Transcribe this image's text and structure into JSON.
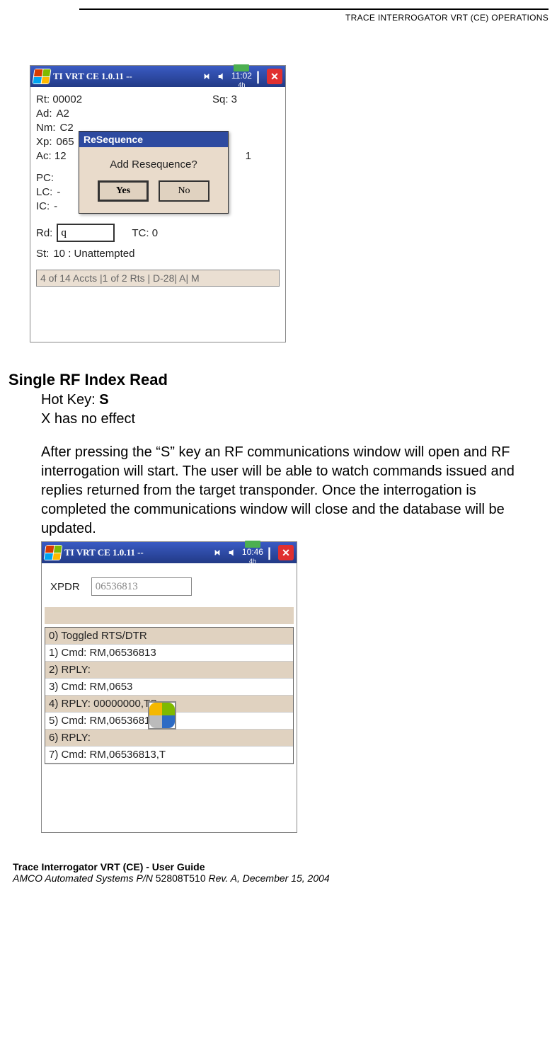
{
  "running_head": "TRACE INTERROGATOR VRT (CE) OPERATIONS",
  "device1": {
    "titlebar": {
      "title": "TI VRT CE 1.0.11 --",
      "clock": "11:02",
      "clock_sub": "4h",
      "batt": "41%"
    },
    "fields": {
      "rt_label": "Rt:",
      "rt_value": "00002",
      "sq_label": "Sq:",
      "sq_value": "3",
      "ad_label": "Ad:",
      "ad_value": "A2",
      "nm_label": "Nm:",
      "nm_value": "C2",
      "xp_label": "Xp:",
      "xp_value": "065",
      "ac_label": "Ac:",
      "ac_value": "12",
      "ac_right": "1",
      "pc_label": "PC:",
      "lc_label": "LC:",
      "lc_value": "-",
      "ic_label": "IC:",
      "ic_value": "-",
      "rd_label": "Rd:",
      "rd_value": "q",
      "tc_label": "TC:",
      "tc_value": "0",
      "st_label": "St:",
      "st_value": "10 : Unattempted"
    },
    "statusbar": "4 of 14 Accts |1 of 2 Rts | D-28| A| M",
    "modal": {
      "title": "ReSequence",
      "prompt": "Add Resequence?",
      "yes": "Yes",
      "no": "No"
    }
  },
  "section": {
    "heading": "Single RF Index Read",
    "hotkey_label": "Hot Key: ",
    "hotkey": "S",
    "x_note": "X has no effect",
    "para": "After pressing the “S” key an RF communications window will open and RF interrogation will start. The user will be able to watch commands issued and replies returned from the target transponder. Once the interrogation is completed the communications window will close and the database will be updated."
  },
  "device2": {
    "titlebar": {
      "title": "TI VRT CE 1.0.11 --",
      "clock": "10:46",
      "clock_sub": "4h",
      "batt": "40%"
    },
    "xpdr_label": "XPDR",
    "xpdr_value": "06536813",
    "log": [
      "0) Toggled RTS/DTR",
      "1) Cmd: RM,06536813",
      "2) RPLY:",
      "3) Cmd: RM,0653",
      "4) RPLY: 00000000,TS",
      "5) Cmd: RM,06536813,T",
      "6) RPLY:",
      "7) Cmd: RM,06536813,T"
    ]
  },
  "footer": {
    "line1": "Trace Interrogator VRT (CE) - User Guide",
    "line2_pre": "AMCO Automated Systems P/N ",
    "pn": "52808T510",
    "line2_post": " Rev. A, December 15, 2004"
  }
}
